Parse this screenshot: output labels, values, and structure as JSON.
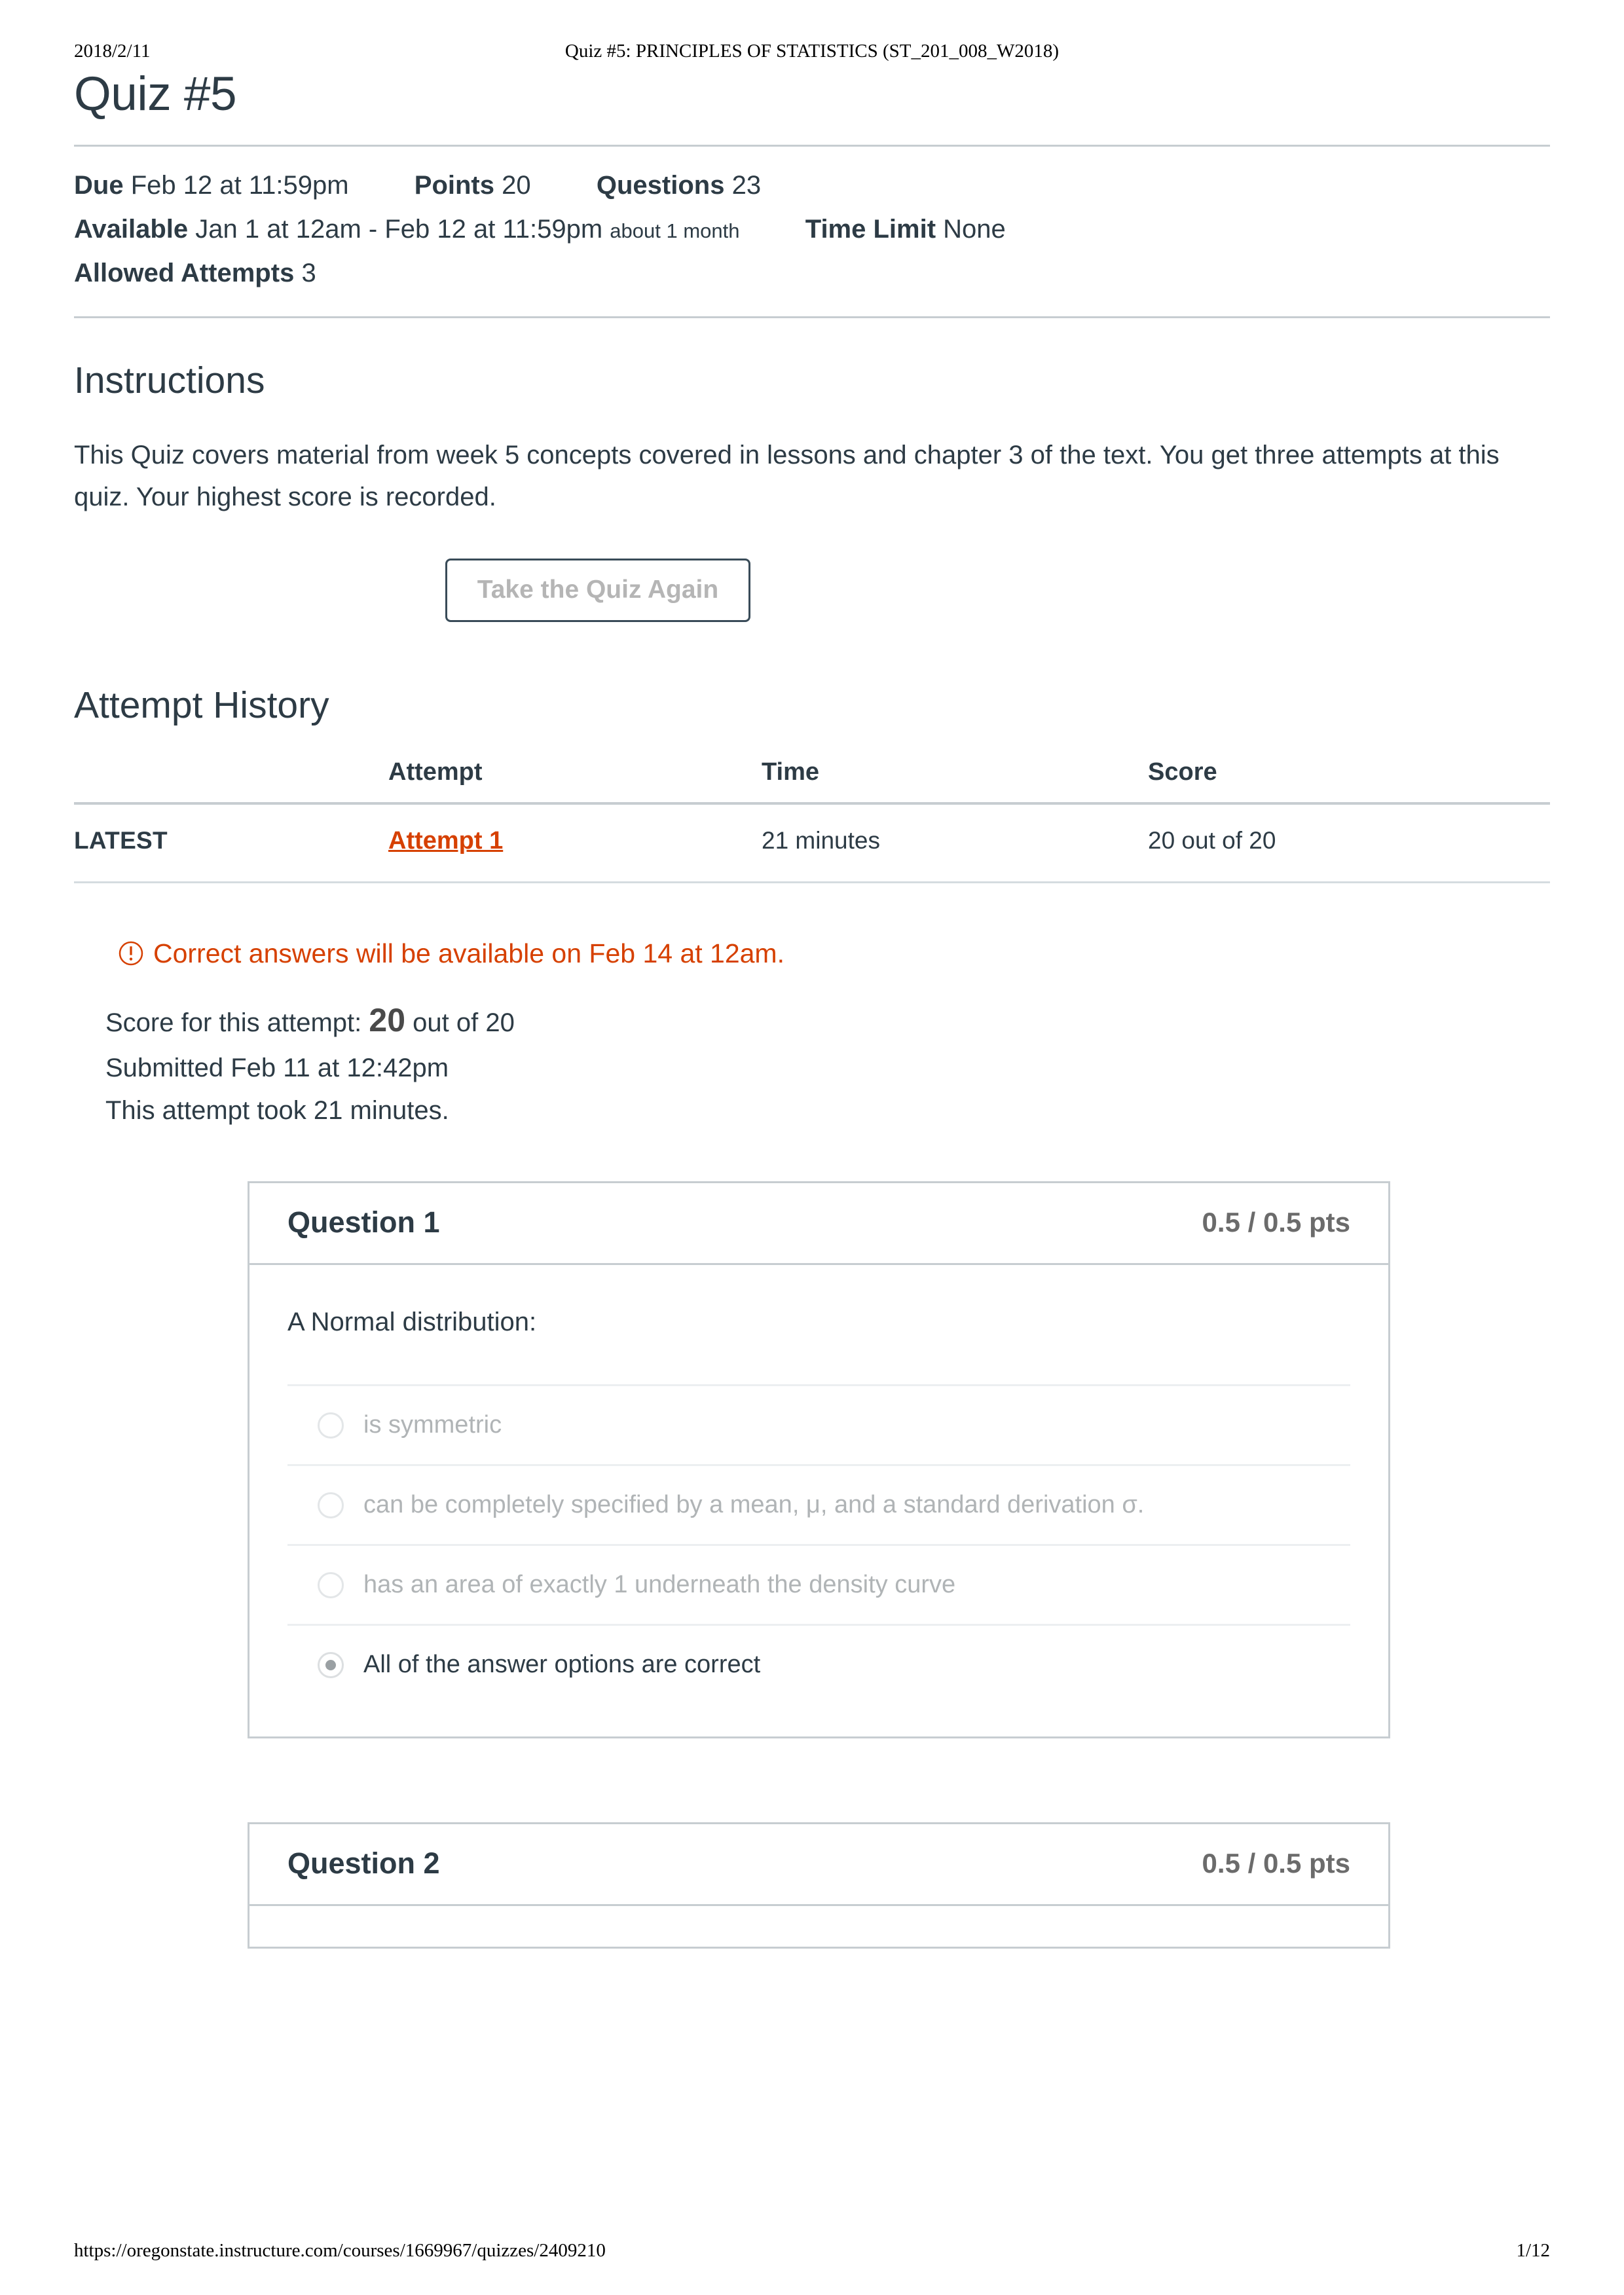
{
  "print": {
    "date": "2018/2/11",
    "doc_title": "Quiz #5: PRINCIPLES OF STATISTICS (ST_201_008_W2018)",
    "footer_url": "https://oregonstate.instructure.com/courses/1669967/quizzes/2409210",
    "page_number": "1/12"
  },
  "quiz": {
    "title": "Quiz #5",
    "meta": {
      "due_label": "Due",
      "due_value": "Feb 12 at 11:59pm",
      "points_label": "Points",
      "points_value": "20",
      "questions_label": "Questions",
      "questions_value": "23",
      "available_label": "Available",
      "available_value": "Jan 1 at 12am - Feb 12 at 11:59pm",
      "available_duration": "about 1 month",
      "time_limit_label": "Time Limit",
      "time_limit_value": "None",
      "allowed_attempts_label": "Allowed Attempts",
      "allowed_attempts_value": "3"
    }
  },
  "instructions": {
    "heading": "Instructions",
    "body": "This Quiz covers material from week 5 concepts covered in lessons and chapter 3 of the text. You get three attempts at this quiz. Your highest score is recorded.",
    "retake_button": "Take the Quiz Again"
  },
  "attempt_history": {
    "heading": "Attempt History",
    "columns": [
      "",
      "Attempt",
      "Time",
      "Score"
    ],
    "rows": [
      {
        "flag": "LATEST",
        "attempt": "Attempt 1 ",
        "time": "21 minutes",
        "score": "20 out of 20"
      }
    ]
  },
  "alert": {
    "icon": "exclamation-circle-icon",
    "text": "Correct answers will be available on Feb 14 at 12am."
  },
  "attempt_summary": {
    "score_prefix": "Score for this attempt:",
    "score_value": "20",
    "score_suffix": "out of 20",
    "submitted": "Submitted Feb 11 at 12:42pm",
    "duration": "This attempt took 21 minutes."
  },
  "questions": [
    {
      "name": "Question 1",
      "points": "0.5 / 0.5 pts",
      "text": "A Normal distribution:",
      "answers": [
        {
          "label": "is symmetric",
          "selected": false
        },
        {
          "label": "can be completely specified by a mean, μ, and a standard derivation σ.",
          "selected": false
        },
        {
          "label": "has an area of exactly 1 underneath the density curve",
          "selected": false
        },
        {
          "label": "All of the answer options are correct",
          "selected": true
        }
      ]
    },
    {
      "name": "Question 2",
      "points": "0.5 / 0.5 pts",
      "text": "",
      "answers": []
    }
  ],
  "colors": {
    "link_orange": "#d64000",
    "text": "#2d3b45",
    "muted": "#b0b4b6",
    "rule": "#c7cdd1"
  }
}
